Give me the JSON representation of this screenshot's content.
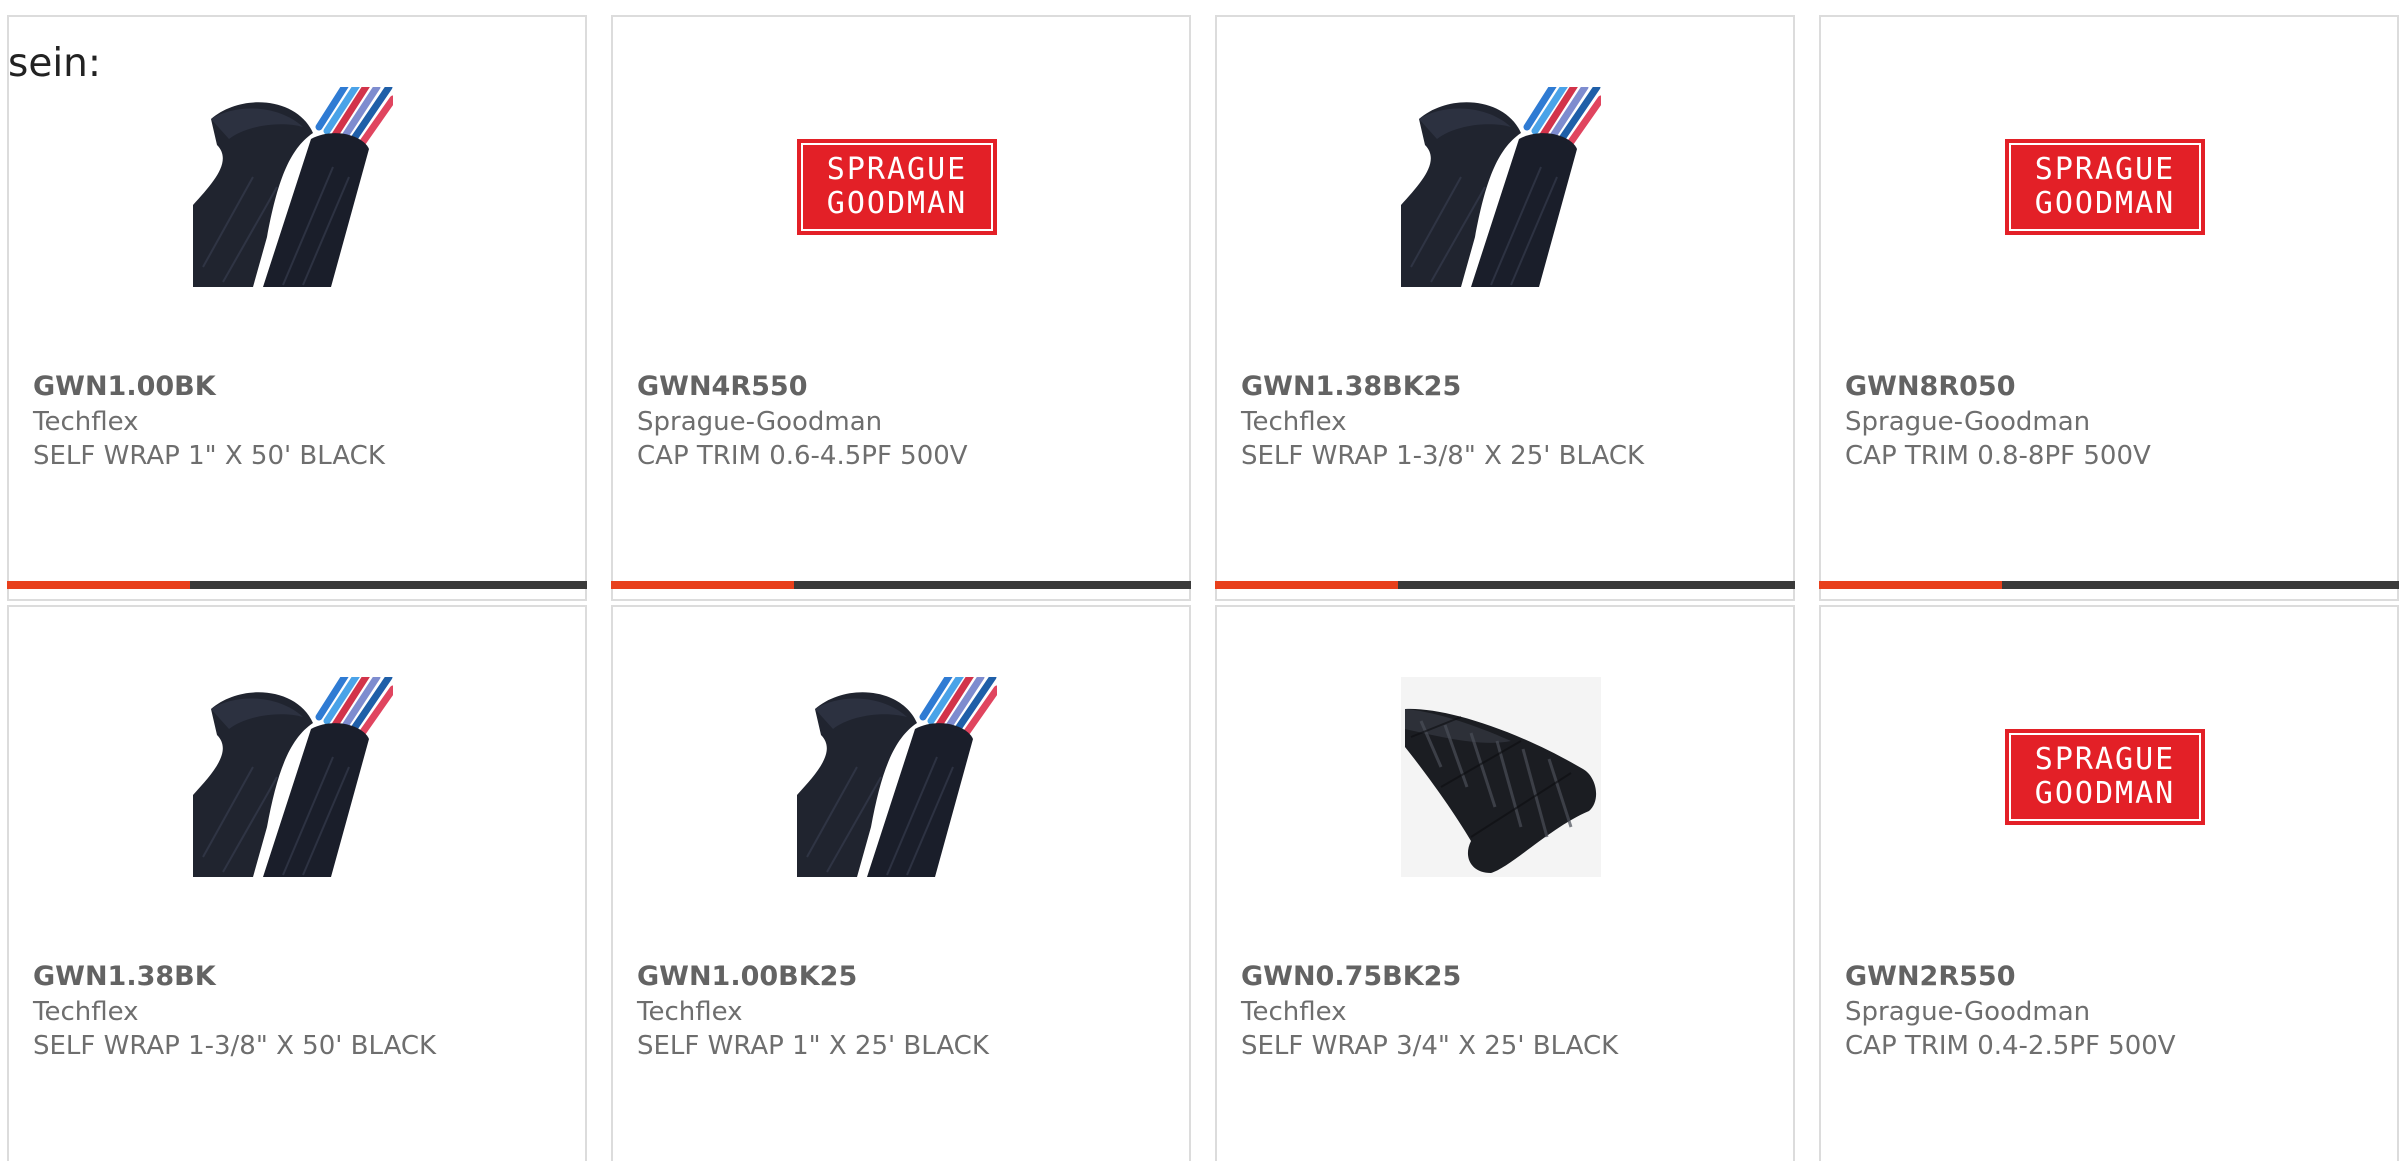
{
  "intro": {
    "text": "sein:"
  },
  "colors": {
    "accent": "#e8401c",
    "bar": "#3a3a3a",
    "brand_red": "#e32027"
  },
  "logo": {
    "line1": "SPRAGUE",
    "line2": "GOODMAN"
  },
  "products": [
    {
      "part": "GWN1.00BK",
      "maker": "Techflex",
      "desc": "SELF WRAP 1\" X 50' BLACK",
      "image": "braided-sleeve-wires"
    },
    {
      "part": "GWN4R550",
      "maker": "Sprague-Goodman",
      "desc": "CAP TRIM 0.6-4.5PF 500V",
      "image": "sprague-goodman-logo"
    },
    {
      "part": "GWN1.38BK25",
      "maker": "Techflex",
      "desc": "SELF WRAP 1-3/8\" X 25' BLACK",
      "image": "braided-sleeve-wires"
    },
    {
      "part": "GWN8R050",
      "maker": "Sprague-Goodman",
      "desc": "CAP TRIM 0.8-8PF 500V",
      "image": "sprague-goodman-logo"
    },
    {
      "part": "GWN1.38BK",
      "maker": "Techflex",
      "desc": "SELF WRAP 1-3/8\" X 50' BLACK",
      "image": "braided-sleeve-wires"
    },
    {
      "part": "GWN1.00BK25",
      "maker": "Techflex",
      "desc": "SELF WRAP 1\" X 25' BLACK",
      "image": "braided-sleeve-wires"
    },
    {
      "part": "GWN0.75BK25",
      "maker": "Techflex",
      "desc": "SELF WRAP 3/4\" X 25' BLACK",
      "image": "braided-sleeve-flat"
    },
    {
      "part": "GWN2R550",
      "maker": "Sprague-Goodman",
      "desc": "CAP TRIM 0.4-2.5PF 500V",
      "image": "sprague-goodman-logo"
    }
  ]
}
